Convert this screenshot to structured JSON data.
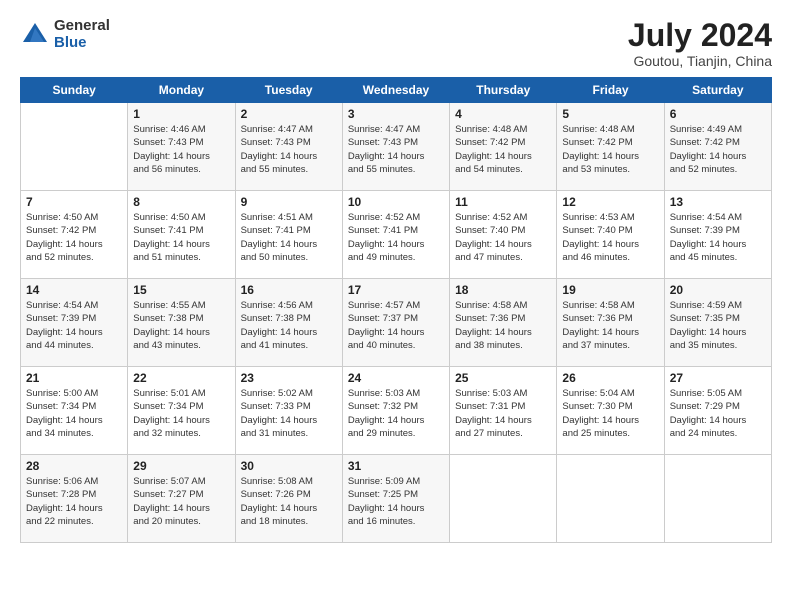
{
  "logo": {
    "general": "General",
    "blue": "Blue"
  },
  "header": {
    "month_year": "July 2024",
    "location": "Goutou, Tianjin, China"
  },
  "weekdays": [
    "Sunday",
    "Monday",
    "Tuesday",
    "Wednesday",
    "Thursday",
    "Friday",
    "Saturday"
  ],
  "weeks": [
    [
      {
        "day": "",
        "content": ""
      },
      {
        "day": "1",
        "content": "Sunrise: 4:46 AM\nSunset: 7:43 PM\nDaylight: 14 hours\nand 56 minutes."
      },
      {
        "day": "2",
        "content": "Sunrise: 4:47 AM\nSunset: 7:43 PM\nDaylight: 14 hours\nand 55 minutes."
      },
      {
        "day": "3",
        "content": "Sunrise: 4:47 AM\nSunset: 7:43 PM\nDaylight: 14 hours\nand 55 minutes."
      },
      {
        "day": "4",
        "content": "Sunrise: 4:48 AM\nSunset: 7:42 PM\nDaylight: 14 hours\nand 54 minutes."
      },
      {
        "day": "5",
        "content": "Sunrise: 4:48 AM\nSunset: 7:42 PM\nDaylight: 14 hours\nand 53 minutes."
      },
      {
        "day": "6",
        "content": "Sunrise: 4:49 AM\nSunset: 7:42 PM\nDaylight: 14 hours\nand 52 minutes."
      }
    ],
    [
      {
        "day": "7",
        "content": "Sunrise: 4:50 AM\nSunset: 7:42 PM\nDaylight: 14 hours\nand 52 minutes."
      },
      {
        "day": "8",
        "content": "Sunrise: 4:50 AM\nSunset: 7:41 PM\nDaylight: 14 hours\nand 51 minutes."
      },
      {
        "day": "9",
        "content": "Sunrise: 4:51 AM\nSunset: 7:41 PM\nDaylight: 14 hours\nand 50 minutes."
      },
      {
        "day": "10",
        "content": "Sunrise: 4:52 AM\nSunset: 7:41 PM\nDaylight: 14 hours\nand 49 minutes."
      },
      {
        "day": "11",
        "content": "Sunrise: 4:52 AM\nSunset: 7:40 PM\nDaylight: 14 hours\nand 47 minutes."
      },
      {
        "day": "12",
        "content": "Sunrise: 4:53 AM\nSunset: 7:40 PM\nDaylight: 14 hours\nand 46 minutes."
      },
      {
        "day": "13",
        "content": "Sunrise: 4:54 AM\nSunset: 7:39 PM\nDaylight: 14 hours\nand 45 minutes."
      }
    ],
    [
      {
        "day": "14",
        "content": "Sunrise: 4:54 AM\nSunset: 7:39 PM\nDaylight: 14 hours\nand 44 minutes."
      },
      {
        "day": "15",
        "content": "Sunrise: 4:55 AM\nSunset: 7:38 PM\nDaylight: 14 hours\nand 43 minutes."
      },
      {
        "day": "16",
        "content": "Sunrise: 4:56 AM\nSunset: 7:38 PM\nDaylight: 14 hours\nand 41 minutes."
      },
      {
        "day": "17",
        "content": "Sunrise: 4:57 AM\nSunset: 7:37 PM\nDaylight: 14 hours\nand 40 minutes."
      },
      {
        "day": "18",
        "content": "Sunrise: 4:58 AM\nSunset: 7:36 PM\nDaylight: 14 hours\nand 38 minutes."
      },
      {
        "day": "19",
        "content": "Sunrise: 4:58 AM\nSunset: 7:36 PM\nDaylight: 14 hours\nand 37 minutes."
      },
      {
        "day": "20",
        "content": "Sunrise: 4:59 AM\nSunset: 7:35 PM\nDaylight: 14 hours\nand 35 minutes."
      }
    ],
    [
      {
        "day": "21",
        "content": "Sunrise: 5:00 AM\nSunset: 7:34 PM\nDaylight: 14 hours\nand 34 minutes."
      },
      {
        "day": "22",
        "content": "Sunrise: 5:01 AM\nSunset: 7:34 PM\nDaylight: 14 hours\nand 32 minutes."
      },
      {
        "day": "23",
        "content": "Sunrise: 5:02 AM\nSunset: 7:33 PM\nDaylight: 14 hours\nand 31 minutes."
      },
      {
        "day": "24",
        "content": "Sunrise: 5:03 AM\nSunset: 7:32 PM\nDaylight: 14 hours\nand 29 minutes."
      },
      {
        "day": "25",
        "content": "Sunrise: 5:03 AM\nSunset: 7:31 PM\nDaylight: 14 hours\nand 27 minutes."
      },
      {
        "day": "26",
        "content": "Sunrise: 5:04 AM\nSunset: 7:30 PM\nDaylight: 14 hours\nand 25 minutes."
      },
      {
        "day": "27",
        "content": "Sunrise: 5:05 AM\nSunset: 7:29 PM\nDaylight: 14 hours\nand 24 minutes."
      }
    ],
    [
      {
        "day": "28",
        "content": "Sunrise: 5:06 AM\nSunset: 7:28 PM\nDaylight: 14 hours\nand 22 minutes."
      },
      {
        "day": "29",
        "content": "Sunrise: 5:07 AM\nSunset: 7:27 PM\nDaylight: 14 hours\nand 20 minutes."
      },
      {
        "day": "30",
        "content": "Sunrise: 5:08 AM\nSunset: 7:26 PM\nDaylight: 14 hours\nand 18 minutes."
      },
      {
        "day": "31",
        "content": "Sunrise: 5:09 AM\nSunset: 7:25 PM\nDaylight: 14 hours\nand 16 minutes."
      },
      {
        "day": "",
        "content": ""
      },
      {
        "day": "",
        "content": ""
      },
      {
        "day": "",
        "content": ""
      }
    ]
  ]
}
